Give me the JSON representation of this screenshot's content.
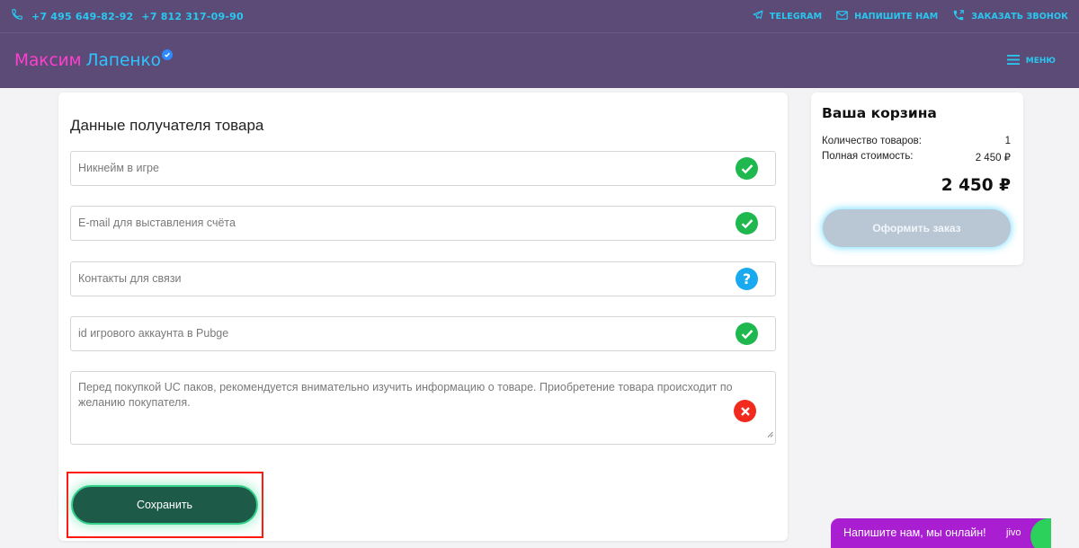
{
  "topbar": {
    "phones": [
      "+7 495 649-82-92",
      "+7 812 317-09-90"
    ],
    "links": [
      {
        "label": "TELEGRAM",
        "icon": "telegram-icon"
      },
      {
        "label": "НАПИШИТЕ НАМ",
        "icon": "mail-icon"
      },
      {
        "label": "ЗАКАЗАТЬ ЗВОНОК",
        "icon": "callback-icon"
      }
    ]
  },
  "header": {
    "logo_first": "Максим",
    "logo_last": "Лапенко",
    "menu_label": "МЕНЮ"
  },
  "form": {
    "title": "Данные получателя товара",
    "fields": [
      {
        "placeholder": "Никнейм в игре",
        "status": "valid"
      },
      {
        "placeholder": "E-mail для выставления счёта",
        "status": "valid"
      },
      {
        "placeholder": "Контакты для связи",
        "status": "unknown"
      },
      {
        "placeholder": "id игрового аккаунта в Pubge",
        "status": "valid"
      }
    ],
    "textarea": {
      "placeholder": "Перед покупкой UC паков, рекомендуется внимательно изучить информацию о товаре. Приобретение товара происходит по желанию покупателя.",
      "status": "invalid"
    },
    "save_label": "Сохранить"
  },
  "cart": {
    "title": "Ваша корзина",
    "count_label": "Количество товаров:",
    "count_value": "1",
    "cost_label": "Полная стоимость:",
    "cost_value": "2 450 ₽",
    "total": "2 450 ₽",
    "order_label": "Оформить заказ"
  },
  "chat": {
    "label": "Напишите нам, мы онлайн!",
    "brand": "jivo"
  },
  "colors": {
    "header_bg": "#5c4a77",
    "accent_cyan": "#28c8f0",
    "valid": "#1fb84f",
    "unknown": "#19a9ee",
    "invalid": "#f22a1d",
    "save_btn": "#1d5a47",
    "chat_bg": "#a91ed0"
  }
}
